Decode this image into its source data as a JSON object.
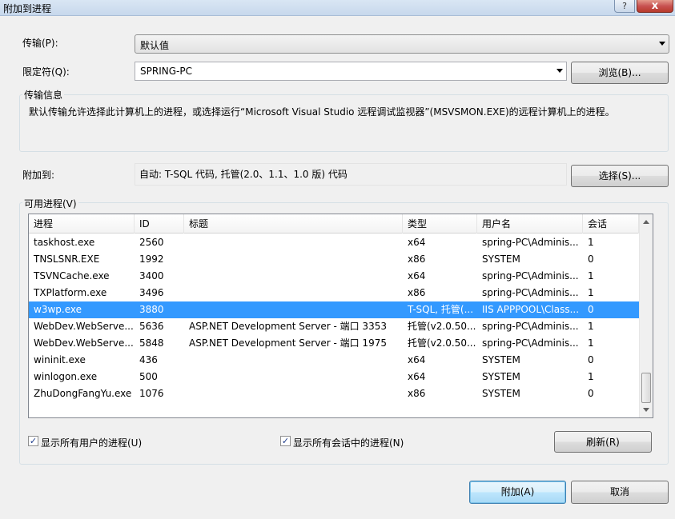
{
  "dialog": {
    "title": "附加到进程",
    "help_glyph": "?",
    "close_glyph": "x"
  },
  "transport": {
    "label": "传输(P):",
    "value": "默认值"
  },
  "qualifier": {
    "label": "限定符(Q):",
    "value": "SPRING-PC",
    "browse_button": "浏览(B)..."
  },
  "transport_info": {
    "title": "传输信息",
    "text": "默认传输允许选择此计算机上的进程，或选择运行“Microsoft Visual Studio 远程调试监视器”(MSVSMON.EXE)的远程计算机上的进程。"
  },
  "attach_to": {
    "label": "附加到:",
    "value": "自动: T-SQL 代码, 托管(2.0、1.1、1.0 版) 代码",
    "select_button": "选择(S)..."
  },
  "available_processes": {
    "title": "可用进程(V)",
    "columns": [
      "进程",
      "ID",
      "标题",
      "类型",
      "用户名",
      "会话"
    ],
    "rows": [
      [
        "taskhost.exe",
        "2560",
        "",
        "x64",
        "spring-PC\\Adminis...",
        "1"
      ],
      [
        "TNSLSNR.EXE",
        "1992",
        "",
        "x86",
        "SYSTEM",
        "0"
      ],
      [
        "TSVNCache.exe",
        "3400",
        "",
        "x64",
        "spring-PC\\Adminis...",
        "1"
      ],
      [
        "TXPlatform.exe",
        "3496",
        "",
        "x86",
        "spring-PC\\Adminis...",
        "1"
      ],
      [
        "w3wp.exe",
        "3880",
        "",
        "T-SQL, 托管(...",
        "IIS APPPOOL\\Class...",
        "0"
      ],
      [
        "WebDev.WebServe...",
        "5636",
        "ASP.NET Development Server - 端口 3353",
        "托管(v2.0.50...",
        "spring-PC\\Adminis...",
        "1"
      ],
      [
        "WebDev.WebServe...",
        "5848",
        "ASP.NET Development Server - 端口 1975",
        "托管(v2.0.50...",
        "spring-PC\\Adminis...",
        "1"
      ],
      [
        "wininit.exe",
        "436",
        "",
        "x64",
        "SYSTEM",
        "0"
      ],
      [
        "winlogon.exe",
        "500",
        "",
        "x64",
        "SYSTEM",
        "1"
      ],
      [
        "ZhuDongFangYu.exe",
        "1076",
        "",
        "x86",
        "SYSTEM",
        "0"
      ]
    ],
    "selected_row": 4
  },
  "options": {
    "show_all_users": {
      "label": "显示所有用户的进程(U)",
      "checked": true
    },
    "show_all_sessions": {
      "label": "显示所有会话中的进程(N)",
      "checked": true
    },
    "check_glyph": "✓",
    "refresh_button": "刷新(R)"
  },
  "footer": {
    "attach_button": "附加(A)",
    "cancel_button": "取消"
  }
}
